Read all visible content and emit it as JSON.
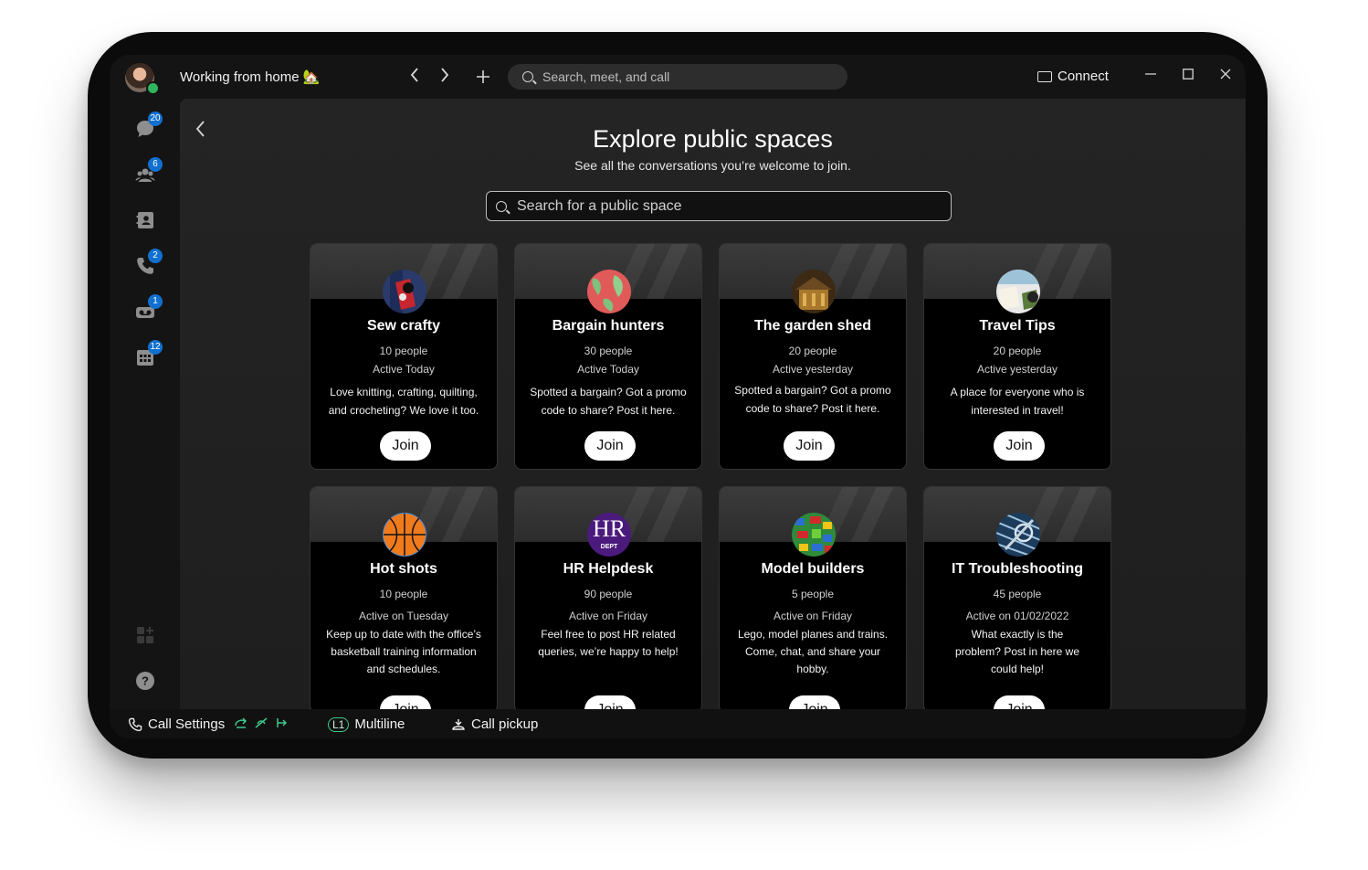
{
  "header": {
    "status": "Working from home 🏡",
    "search_placeholder": "Search, meet, and call",
    "connect_label": "Connect"
  },
  "rail": {
    "messaging_badge": "20",
    "teams_badge": "6",
    "calling_badge": "2",
    "voicemail_badge": "1",
    "meetings_badge": "12"
  },
  "main": {
    "title": "Explore public spaces",
    "subtitle": "See all the conversations you’re welcome to join.",
    "search_placeholder": "Search for a public space",
    "join_label": "Join",
    "spaces": [
      {
        "name": "Sew crafty",
        "people": "10 people",
        "active": "Active Today",
        "description": "Love knitting, crafting, quilting, and crocheting? We love it too."
      },
      {
        "name": "Bargain hunters",
        "people": "30 people",
        "active": "Active Today",
        "description": "Spotted a bargain? Got a promo code to share? Post it here."
      },
      {
        "name": "The garden shed",
        "people": "20 people",
        "active": "Active yesterday",
        "description": "Spotted a bargain? Got a promo code to share? Post it here."
      },
      {
        "name": "Travel Tips",
        "people": "20 people",
        "active": "Active yesterday",
        "description": "A place for everyone who is interested in travel!"
      },
      {
        "name": "Hot shots",
        "people": "10 people",
        "active": "Active on Tuesday",
        "description": "Keep up to date with the office’s basketball training information and schedules."
      },
      {
        "name": "HR Helpdesk",
        "people": "90 people",
        "active": "Active on Friday",
        "description": "Feel free to post HR related queries, we’re happy to help!"
      },
      {
        "name": "Model builders",
        "people": "5 people",
        "active": "Active on Friday",
        "description": "Lego, model planes and trains. Come, chat, and share your hobby."
      },
      {
        "name": "IT Troubleshooting",
        "people": "45 people",
        "active": "Active on 01/02/2022",
        "description": "What exactly is the problem? Post in here we could help!"
      }
    ],
    "hr_logo_text": "HR",
    "hr_logo_sub": "DEPT"
  },
  "bottom": {
    "call_settings": "Call Settings",
    "line_badge": "L1",
    "multiline": "Multiline",
    "call_pickup": "Call pickup"
  },
  "colors": {
    "accent_blue": "#1170cf",
    "presence_green": "#2fb55d",
    "line_green": "#3fc88a"
  }
}
